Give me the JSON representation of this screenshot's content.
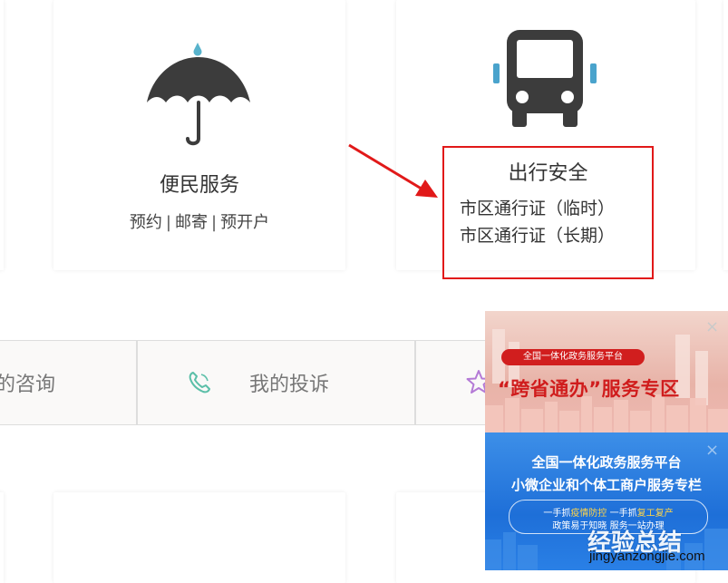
{
  "cards": [
    {
      "title": "便民服务",
      "icon": "umbrella-icon",
      "links": [
        "预约",
        "邮寄",
        "预开户"
      ]
    },
    {
      "title": "出行安全",
      "icon": "bus-icon",
      "links": [
        "市区通行证（临时）",
        "市区通行证（长期）"
      ]
    }
  ],
  "link_separator": "|",
  "tabs": [
    {
      "label": "的咨询",
      "icon": ""
    },
    {
      "label": "我的投诉",
      "icon": "phone-icon"
    },
    {
      "label": "",
      "icon": "star-icon"
    }
  ],
  "annotation": {
    "color": "#e11919"
  },
  "ad": {
    "top": {
      "pill": "全国一体化政务服务平台",
      "headline": "“跨省通办”服务专区"
    },
    "bottom": {
      "line1": "全国一体化政务服务平台",
      "line2": "小微企业和个体工商户服务专栏",
      "slogan_a": "一手抓",
      "slogan_b": "疫情防控",
      "slogan_c": " 一手抓",
      "slogan_d": "复工复产",
      "slogan2": "政策易于知晓 服务一站办理"
    },
    "close_glyph": "×"
  },
  "watermark": {
    "text": "经验总结",
    "url": "jingyanzongjie.com"
  }
}
